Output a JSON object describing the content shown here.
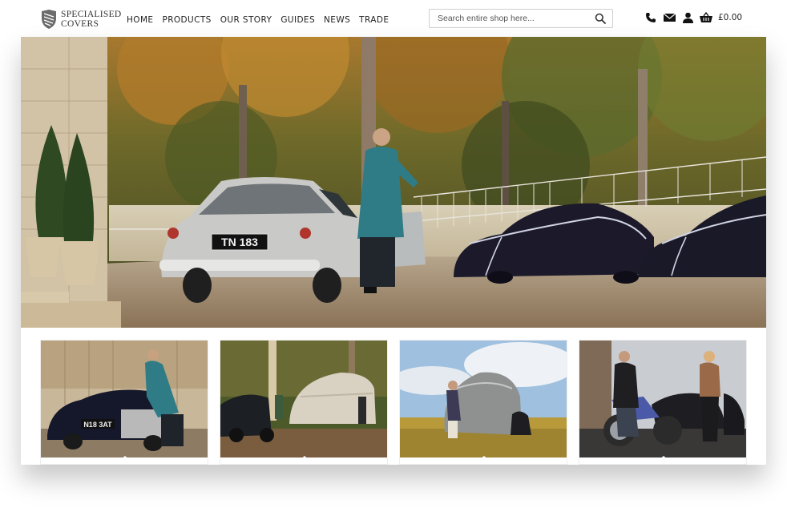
{
  "brand": {
    "line1": "SPECIALISED",
    "line2": "COVERS"
  },
  "nav": [
    "HOME",
    "PRODUCTS",
    "OUR STORY",
    "GUIDES",
    "NEWS",
    "TRADE"
  ],
  "search": {
    "placeholder": "Search entire shop here..."
  },
  "header_icons": [
    "phone-icon",
    "email-icon",
    "account-icon",
    "basket-icon"
  ],
  "cart": {
    "total": "£0.00"
  },
  "hero": {
    "plate": "TN 183"
  },
  "tiles": [
    {
      "plate": "N18 3AT"
    },
    {},
    {},
    {}
  ]
}
